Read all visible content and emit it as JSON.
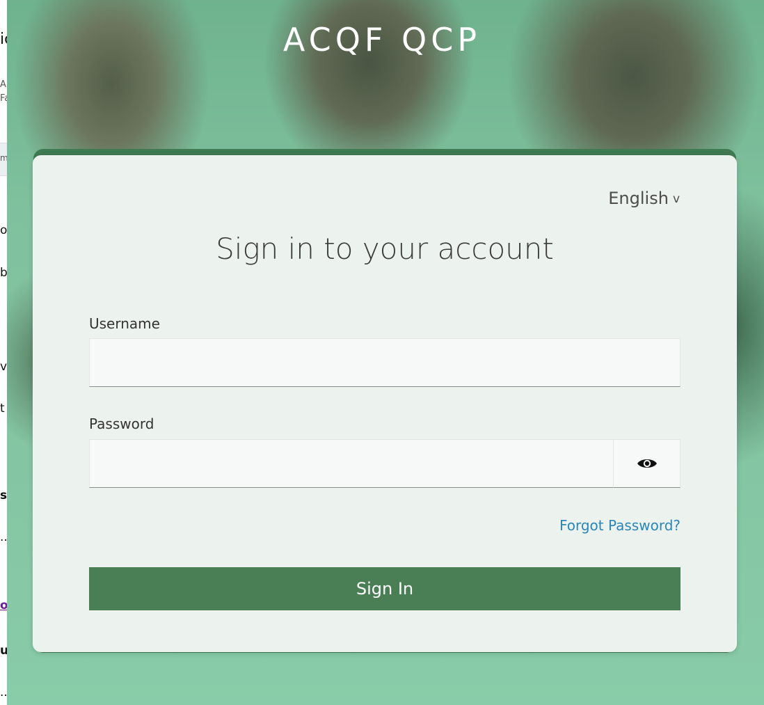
{
  "background_page": {
    "fragments": [
      "ic",
      "A",
      "Fa",
      "m",
      "o",
      "b",
      "vi",
      "t",
      "s",
      "...",
      "o",
      "ur",
      "..."
    ]
  },
  "brand": {
    "title": "ACQF QCP"
  },
  "login": {
    "language": "English",
    "language_caret": "v",
    "heading": "Sign in to your account",
    "username_label": "Username",
    "username_value": "",
    "password_label": "Password",
    "password_value": "",
    "forgot_password": "Forgot Password?",
    "sign_in_label": "Sign In",
    "show_password_icon": "eye-icon"
  },
  "colors": {
    "primary_button": "#4a7f55",
    "link": "#2a86b8",
    "card_edge": "#3f7a52"
  }
}
